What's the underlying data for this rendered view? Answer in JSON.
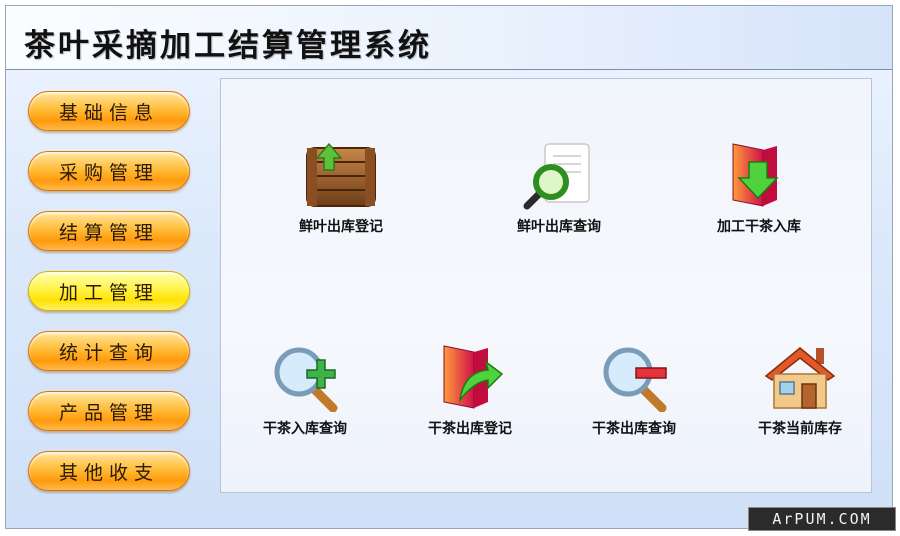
{
  "app": {
    "title": "茶叶采摘加工结算管理系统"
  },
  "sidebar": {
    "items": [
      {
        "label": "基础信息"
      },
      {
        "label": "采购管理"
      },
      {
        "label": "结算管理"
      },
      {
        "label": "加工管理",
        "active": true
      },
      {
        "label": "统计查询"
      },
      {
        "label": "产品管理"
      },
      {
        "label": "其他收支"
      }
    ]
  },
  "main": {
    "tiles": [
      {
        "label": "鲜叶出库登记",
        "icon": "crate-upload-icon"
      },
      {
        "label": "鲜叶出库查询",
        "icon": "document-search-icon"
      },
      {
        "label": "加工干茶入库",
        "icon": "folder-download-icon"
      },
      {
        "label": "干茶入库查询",
        "icon": "magnifier-plus-icon"
      },
      {
        "label": "干茶出库登记",
        "icon": "folder-arrow-out-icon"
      },
      {
        "label": "干茶出库查询",
        "icon": "magnifier-minus-icon"
      },
      {
        "label": "干茶当前库存",
        "icon": "house-icon"
      }
    ]
  },
  "watermark": {
    "text": "ArPUM.COM"
  },
  "colors": {
    "button_orange": "#ffa51a",
    "button_active": "#fff34a",
    "window_bg": "#dce9fb"
  }
}
